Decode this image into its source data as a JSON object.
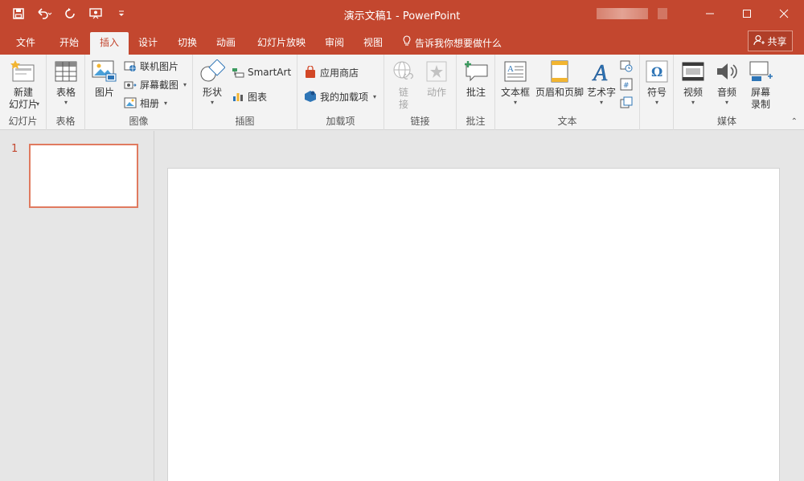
{
  "app": {
    "window_title": "演示文稿1  -  PowerPoint"
  },
  "colors": {
    "accent": "#c3472f",
    "ribbon_bg": "#f3f3f3",
    "workspace_bg": "#e6e6e6",
    "thumb_border": "#e07a5f"
  },
  "qat": {
    "icons": [
      "save-icon",
      "undo-icon",
      "redo-icon",
      "presenter-icon",
      "customize-icon"
    ]
  },
  "tabs": [
    {
      "label": "文件"
    },
    {
      "label": "开始"
    },
    {
      "label": "插入",
      "active": true
    },
    {
      "label": "设计"
    },
    {
      "label": "切换"
    },
    {
      "label": "动画"
    },
    {
      "label": "幻灯片放映"
    },
    {
      "label": "审阅"
    },
    {
      "label": "视图"
    }
  ],
  "tell_me": "告诉我你想要做什么",
  "share_label": "共享",
  "ribbon": {
    "slides": {
      "label": "幻灯片",
      "new_slide": "新建\n幻灯片"
    },
    "tables": {
      "label": "表格",
      "table": "表格"
    },
    "images": {
      "label": "图像",
      "picture": "图片",
      "online_pictures": "联机图片",
      "screenshot": "屏幕截图",
      "album": "相册"
    },
    "illustrations": {
      "label": "插图",
      "shapes": "形状",
      "smartart": "SmartArt",
      "chart": "图表"
    },
    "addins": {
      "label": "加载项",
      "store": "应用商店",
      "my_addins": "我的加载项"
    },
    "links": {
      "label": "链接",
      "link": "链\n接",
      "action": "动作"
    },
    "comments": {
      "label": "批注",
      "comment": "批注"
    },
    "text": {
      "label": "文本",
      "textbox": "文本框",
      "header_footer": "页眉和页脚",
      "wordart": "艺术字"
    },
    "symbols": {
      "symbol": "符号"
    },
    "media": {
      "label": "媒体",
      "video": "视频",
      "audio": "音频",
      "screen_recording": "屏幕\n录制"
    }
  },
  "slides_pane": {
    "slide_number": "1"
  }
}
